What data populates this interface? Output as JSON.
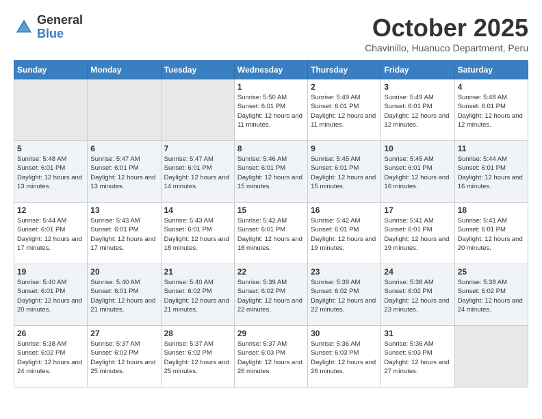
{
  "logo": {
    "general": "General",
    "blue": "Blue"
  },
  "title": "October 2025",
  "location": "Chavinillo, Huanuco Department, Peru",
  "days_header": [
    "Sunday",
    "Monday",
    "Tuesday",
    "Wednesday",
    "Thursday",
    "Friday",
    "Saturday"
  ],
  "weeks": [
    [
      {
        "day": "",
        "sunrise": "",
        "sunset": "",
        "daylight": "",
        "empty": true
      },
      {
        "day": "",
        "sunrise": "",
        "sunset": "",
        "daylight": "",
        "empty": true
      },
      {
        "day": "",
        "sunrise": "",
        "sunset": "",
        "daylight": "",
        "empty": true
      },
      {
        "day": "1",
        "sunrise": "Sunrise: 5:50 AM",
        "sunset": "Sunset: 6:01 PM",
        "daylight": "Daylight: 12 hours and 11 minutes.",
        "empty": false
      },
      {
        "day": "2",
        "sunrise": "Sunrise: 5:49 AM",
        "sunset": "Sunset: 6:01 PM",
        "daylight": "Daylight: 12 hours and 11 minutes.",
        "empty": false
      },
      {
        "day": "3",
        "sunrise": "Sunrise: 5:49 AM",
        "sunset": "Sunset: 6:01 PM",
        "daylight": "Daylight: 12 hours and 12 minutes.",
        "empty": false
      },
      {
        "day": "4",
        "sunrise": "Sunrise: 5:48 AM",
        "sunset": "Sunset: 6:01 PM",
        "daylight": "Daylight: 12 hours and 12 minutes.",
        "empty": false
      }
    ],
    [
      {
        "day": "5",
        "sunrise": "Sunrise: 5:48 AM",
        "sunset": "Sunset: 6:01 PM",
        "daylight": "Daylight: 12 hours and 13 minutes.",
        "empty": false
      },
      {
        "day": "6",
        "sunrise": "Sunrise: 5:47 AM",
        "sunset": "Sunset: 6:01 PM",
        "daylight": "Daylight: 12 hours and 13 minutes.",
        "empty": false
      },
      {
        "day": "7",
        "sunrise": "Sunrise: 5:47 AM",
        "sunset": "Sunset: 6:01 PM",
        "daylight": "Daylight: 12 hours and 14 minutes.",
        "empty": false
      },
      {
        "day": "8",
        "sunrise": "Sunrise: 5:46 AM",
        "sunset": "Sunset: 6:01 PM",
        "daylight": "Daylight: 12 hours and 15 minutes.",
        "empty": false
      },
      {
        "day": "9",
        "sunrise": "Sunrise: 5:45 AM",
        "sunset": "Sunset: 6:01 PM",
        "daylight": "Daylight: 12 hours and 15 minutes.",
        "empty": false
      },
      {
        "day": "10",
        "sunrise": "Sunrise: 5:45 AM",
        "sunset": "Sunset: 6:01 PM",
        "daylight": "Daylight: 12 hours and 16 minutes.",
        "empty": false
      },
      {
        "day": "11",
        "sunrise": "Sunrise: 5:44 AM",
        "sunset": "Sunset: 6:01 PM",
        "daylight": "Daylight: 12 hours and 16 minutes.",
        "empty": false
      }
    ],
    [
      {
        "day": "12",
        "sunrise": "Sunrise: 5:44 AM",
        "sunset": "Sunset: 6:01 PM",
        "daylight": "Daylight: 12 hours and 17 minutes.",
        "empty": false
      },
      {
        "day": "13",
        "sunrise": "Sunrise: 5:43 AM",
        "sunset": "Sunset: 6:01 PM",
        "daylight": "Daylight: 12 hours and 17 minutes.",
        "empty": false
      },
      {
        "day": "14",
        "sunrise": "Sunrise: 5:43 AM",
        "sunset": "Sunset: 6:01 PM",
        "daylight": "Daylight: 12 hours and 18 minutes.",
        "empty": false
      },
      {
        "day": "15",
        "sunrise": "Sunrise: 5:42 AM",
        "sunset": "Sunset: 6:01 PM",
        "daylight": "Daylight: 12 hours and 18 minutes.",
        "empty": false
      },
      {
        "day": "16",
        "sunrise": "Sunrise: 5:42 AM",
        "sunset": "Sunset: 6:01 PM",
        "daylight": "Daylight: 12 hours and 19 minutes.",
        "empty": false
      },
      {
        "day": "17",
        "sunrise": "Sunrise: 5:41 AM",
        "sunset": "Sunset: 6:01 PM",
        "daylight": "Daylight: 12 hours and 19 minutes.",
        "empty": false
      },
      {
        "day": "18",
        "sunrise": "Sunrise: 5:41 AM",
        "sunset": "Sunset: 6:01 PM",
        "daylight": "Daylight: 12 hours and 20 minutes.",
        "empty": false
      }
    ],
    [
      {
        "day": "19",
        "sunrise": "Sunrise: 5:40 AM",
        "sunset": "Sunset: 6:01 PM",
        "daylight": "Daylight: 12 hours and 20 minutes.",
        "empty": false
      },
      {
        "day": "20",
        "sunrise": "Sunrise: 5:40 AM",
        "sunset": "Sunset: 6:01 PM",
        "daylight": "Daylight: 12 hours and 21 minutes.",
        "empty": false
      },
      {
        "day": "21",
        "sunrise": "Sunrise: 5:40 AM",
        "sunset": "Sunset: 6:02 PM",
        "daylight": "Daylight: 12 hours and 21 minutes.",
        "empty": false
      },
      {
        "day": "22",
        "sunrise": "Sunrise: 5:39 AM",
        "sunset": "Sunset: 6:02 PM",
        "daylight": "Daylight: 12 hours and 22 minutes.",
        "empty": false
      },
      {
        "day": "23",
        "sunrise": "Sunrise: 5:39 AM",
        "sunset": "Sunset: 6:02 PM",
        "daylight": "Daylight: 12 hours and 22 minutes.",
        "empty": false
      },
      {
        "day": "24",
        "sunrise": "Sunrise: 5:38 AM",
        "sunset": "Sunset: 6:02 PM",
        "daylight": "Daylight: 12 hours and 23 minutes.",
        "empty": false
      },
      {
        "day": "25",
        "sunrise": "Sunrise: 5:38 AM",
        "sunset": "Sunset: 6:02 PM",
        "daylight": "Daylight: 12 hours and 24 minutes.",
        "empty": false
      }
    ],
    [
      {
        "day": "26",
        "sunrise": "Sunrise: 5:38 AM",
        "sunset": "Sunset: 6:02 PM",
        "daylight": "Daylight: 12 hours and 24 minutes.",
        "empty": false
      },
      {
        "day": "27",
        "sunrise": "Sunrise: 5:37 AM",
        "sunset": "Sunset: 6:02 PM",
        "daylight": "Daylight: 12 hours and 25 minutes.",
        "empty": false
      },
      {
        "day": "28",
        "sunrise": "Sunrise: 5:37 AM",
        "sunset": "Sunset: 6:02 PM",
        "daylight": "Daylight: 12 hours and 25 minutes.",
        "empty": false
      },
      {
        "day": "29",
        "sunrise": "Sunrise: 5:37 AM",
        "sunset": "Sunset: 6:03 PM",
        "daylight": "Daylight: 12 hours and 26 minutes.",
        "empty": false
      },
      {
        "day": "30",
        "sunrise": "Sunrise: 5:36 AM",
        "sunset": "Sunset: 6:03 PM",
        "daylight": "Daylight: 12 hours and 26 minutes.",
        "empty": false
      },
      {
        "day": "31",
        "sunrise": "Sunrise: 5:36 AM",
        "sunset": "Sunset: 6:03 PM",
        "daylight": "Daylight: 12 hours and 27 minutes.",
        "empty": false
      },
      {
        "day": "",
        "sunrise": "",
        "sunset": "",
        "daylight": "",
        "empty": true
      }
    ]
  ]
}
